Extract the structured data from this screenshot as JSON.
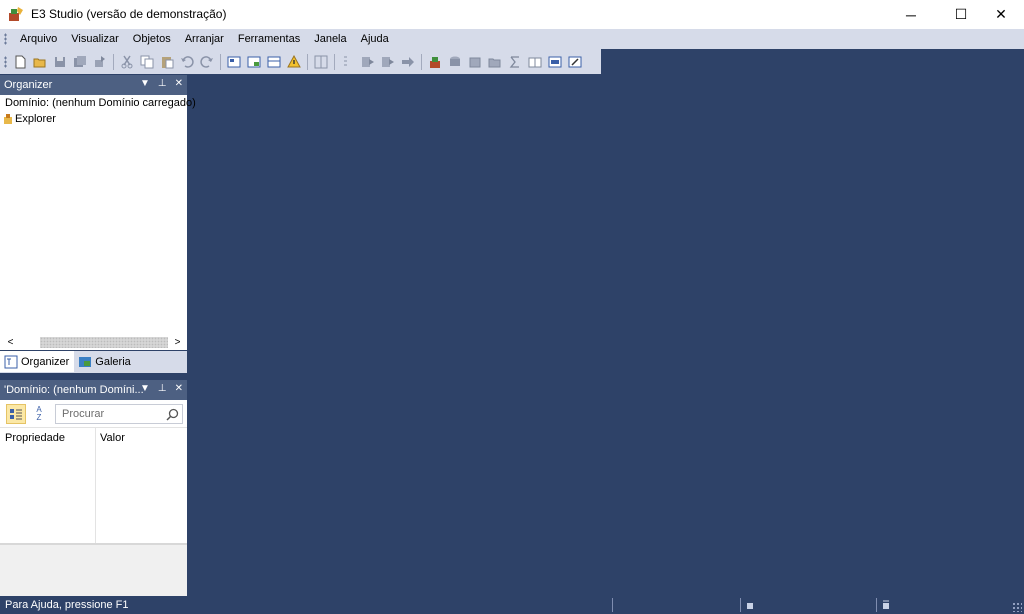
{
  "window": {
    "title": "E3 Studio (versão de demonstração)",
    "controls": {
      "minimize": "─",
      "maximize": "☐",
      "close": "✕"
    }
  },
  "menu": {
    "items": [
      "Arquivo",
      "Visualizar",
      "Objetos",
      "Arranjar",
      "Ferramentas",
      "Janela",
      "Ajuda"
    ]
  },
  "toolbar": {
    "icons": [
      "new-icon",
      "open-icon",
      "save-icon",
      "save-all-icon",
      "publish-icon",
      "cut-icon",
      "copy-icon",
      "paste-icon",
      "undo-icon",
      "redo-icon",
      "screen-icon",
      "viewer-icon",
      "frame-icon",
      "alarm-icon",
      "library-icon",
      "run-icon",
      "run-next-icon",
      "run-all-icon",
      "forward-icon",
      "domain-icon",
      "server-icon",
      "database-icon",
      "folder-icon",
      "sum-icon",
      "book-icon",
      "version-icon",
      "config-icon"
    ]
  },
  "organizer": {
    "title": "Organizer",
    "header_buttons": {
      "dropdown": "▼",
      "pin": "⊥",
      "close": "✕"
    },
    "tree": [
      {
        "label": "Domínio: (nenhum Domínio carregado)",
        "icon": "domain-icon"
      },
      {
        "label": "Explorer",
        "icon": "explorer-icon"
      }
    ],
    "scroll_left": "<",
    "scroll_right": ">",
    "tabs": [
      {
        "label": "Organizer",
        "active": true,
        "icon": "organizer-icon"
      },
      {
        "label": "Galeria",
        "active": false,
        "icon": "gallery-icon"
      }
    ]
  },
  "properties": {
    "title": "'Domínio: (nenhum Domíni...",
    "header_buttons": {
      "dropdown": "▼",
      "pin": "⊥",
      "close": "✕"
    },
    "search_placeholder": "Procurar",
    "sort_label": "A Z",
    "columns": {
      "name": "Propriedade",
      "value": "Valor"
    }
  },
  "status": {
    "help_text": "Para Ajuda, pressione F1"
  },
  "colors": {
    "workspace": "#2e4268",
    "panel_header": "#4d6082",
    "menubar": "#d6dbe9",
    "active_button": "#fbe8a6"
  }
}
